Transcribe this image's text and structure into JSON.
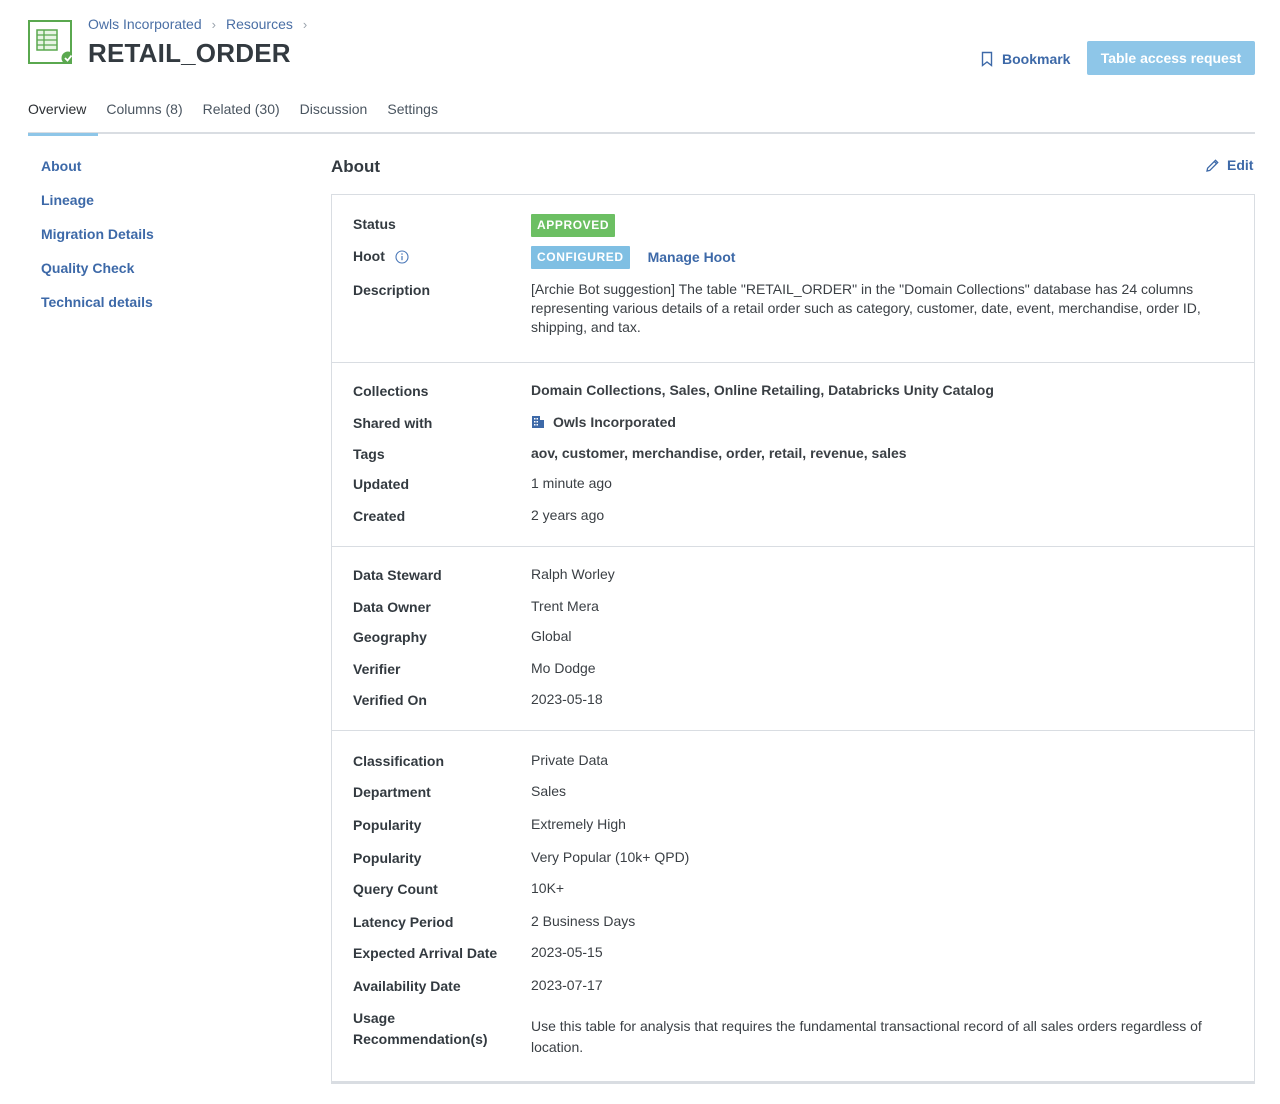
{
  "breadcrumb": [
    "Owls Incorporated",
    "Resources"
  ],
  "title": "RETAIL_ORDER",
  "actions": {
    "bookmark": "Bookmark",
    "access_request": "Table access request"
  },
  "tabs": [
    "Overview",
    "Columns (8)",
    "Related (30)",
    "Discussion",
    "Settings"
  ],
  "active_tab": "Overview",
  "sidenav": [
    "About",
    "Lineage",
    "Migration Details",
    "Quality Check",
    "Technical details"
  ],
  "about": {
    "title": "About",
    "edit_label": "Edit",
    "status_label": "Status",
    "status_value": "APPROVED",
    "hoot_label": "Hoot",
    "hoot_badge": "CONFIGURED",
    "hoot_link": "Manage Hoot",
    "description_label": "Description",
    "description_value": "[Archie Bot suggestion] The table \"RETAIL_ORDER\" in the \"Domain Collections\" database has 24 columns representing various details of a retail order such as category, customer, date, event, merchandise, order ID, shipping, and tax.",
    "collections_label": "Collections",
    "collections_value": "Domain Collections, Sales, Online Retailing, Databricks Unity Catalog",
    "shared_label": "Shared with",
    "shared_value": "Owls Incorporated",
    "tags_label": "Tags",
    "tags_value": "aov, customer, merchandise, order, retail, revenue, sales",
    "updated_label": "Updated",
    "updated_value": "1 minute ago",
    "created_label": "Created",
    "created_value": "2 years ago",
    "steward_label": "Data Steward",
    "steward_value": "Ralph Worley",
    "owner_label": "Data Owner",
    "owner_value": "Trent Mera",
    "geography_label": "Geography",
    "geography_value": "Global",
    "verifier_label": "Verifier",
    "verifier_value": "Mo Dodge",
    "verified_on_label": "Verified On",
    "verified_on_value": "2023-05-18",
    "classification_label": "Classification",
    "classification_value": "Private Data",
    "department_label": "Department",
    "department_value": "Sales",
    "popularity_label": "Popularity",
    "popularity_value": "Extremely High",
    "popularity2_label": "Popularity",
    "popularity2_value": "Very Popular (10k+ QPD)",
    "query_count_label": "Query Count",
    "query_count_value": "10K+",
    "latency_label": "Latency Period",
    "latency_value": "2 Business Days",
    "arrival_label": "Expected Arrival Date",
    "arrival_value": "2023-05-15",
    "availability_label": "Availability Date",
    "availability_value": "2023-07-17",
    "usage_label": "Usage Recommendation(s)",
    "usage_value": "Use this table for analysis that requires the fundamental transactional record of all sales orders regardless of location."
  },
  "colors": {
    "accent": "#8ec6e8",
    "link": "#3d69a8",
    "approved": "#6cbf63",
    "configured": "#7fbfe3"
  }
}
